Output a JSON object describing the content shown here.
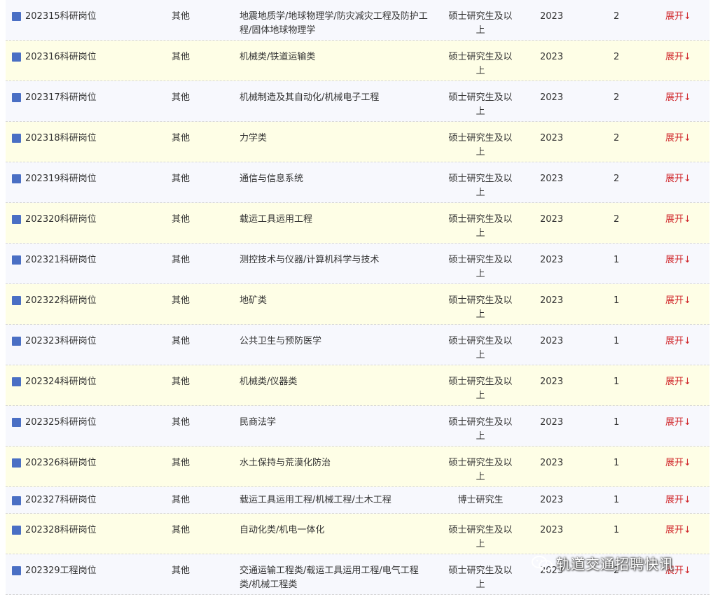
{
  "toggle_label": "展开↓",
  "watermark": "轨道交通招聘快讯",
  "rows": [
    {
      "name": "202315科研岗位",
      "type": "其他",
      "major": "地震地质学/地球物理学/防灾减灾工程及防护工程/固体地球物理学",
      "education": "硕士研究生及以上",
      "year": "2023",
      "count": "2"
    },
    {
      "name": "202316科研岗位",
      "type": "其他",
      "major": "机械类/铁道运输类",
      "education": "硕士研究生及以上",
      "year": "2023",
      "count": "2"
    },
    {
      "name": "202317科研岗位",
      "type": "其他",
      "major": "机械制造及其自动化/机械电子工程",
      "education": "硕士研究生及以上",
      "year": "2023",
      "count": "2"
    },
    {
      "name": "202318科研岗位",
      "type": "其他",
      "major": "力学类",
      "education": "硕士研究生及以上",
      "year": "2023",
      "count": "2"
    },
    {
      "name": "202319科研岗位",
      "type": "其他",
      "major": "通信与信息系统",
      "education": "硕士研究生及以上",
      "year": "2023",
      "count": "2"
    },
    {
      "name": "202320科研岗位",
      "type": "其他",
      "major": "载运工具运用工程",
      "education": "硕士研究生及以上",
      "year": "2023",
      "count": "2"
    },
    {
      "name": "202321科研岗位",
      "type": "其他",
      "major": "测控技术与仪器/计算机科学与技术",
      "education": "硕士研究生及以上",
      "year": "2023",
      "count": "1"
    },
    {
      "name": "202322科研岗位",
      "type": "其他",
      "major": "地矿类",
      "education": "硕士研究生及以上",
      "year": "2023",
      "count": "1"
    },
    {
      "name": "202323科研岗位",
      "type": "其他",
      "major": "公共卫生与预防医学",
      "education": "硕士研究生及以上",
      "year": "2023",
      "count": "1"
    },
    {
      "name": "202324科研岗位",
      "type": "其他",
      "major": "机械类/仪器类",
      "education": "硕士研究生及以上",
      "year": "2023",
      "count": "1"
    },
    {
      "name": "202325科研岗位",
      "type": "其他",
      "major": "民商法学",
      "education": "硕士研究生及以上",
      "year": "2023",
      "count": "1"
    },
    {
      "name": "202326科研岗位",
      "type": "其他",
      "major": "水土保持与荒漠化防治",
      "education": "硕士研究生及以上",
      "year": "2023",
      "count": "1"
    },
    {
      "name": "202327科研岗位",
      "type": "其他",
      "major": "载运工具运用工程/机械工程/土木工程",
      "education": "博士研究生",
      "year": "2023",
      "count": "1"
    },
    {
      "name": "202328科研岗位",
      "type": "其他",
      "major": "自动化类/机电一体化",
      "education": "硕士研究生及以上",
      "year": "2023",
      "count": "1"
    },
    {
      "name": "202329工程岗位",
      "type": "其他",
      "major": "交通运输工程类/载运工具运用工程/电气工程类/机械工程类",
      "education": "硕士研究生及以上",
      "year": "2023",
      "count": "2"
    }
  ]
}
